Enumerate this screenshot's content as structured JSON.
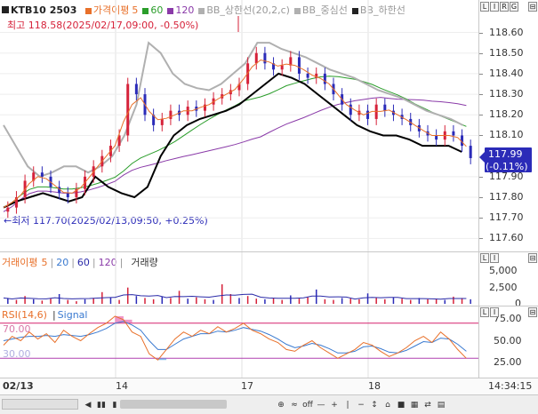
{
  "chart_header": {
    "symbol": "KTB10",
    "code": "2503",
    "legend": [
      {
        "label": "가격이평",
        "color": "#e8702a"
      },
      {
        "label": "5",
        "color": "#e8702a"
      },
      {
        "label": "60",
        "color": "#2a9d2a"
      },
      {
        "label": "120",
        "color": "#8a3aa8"
      },
      {
        "label": "BB_상한선(20,2,c)",
        "color": "#b0b0b0"
      },
      {
        "label": "BB_중심선",
        "color": "#b0b0b0"
      },
      {
        "label": "BB_하한선",
        "color": "#222222"
      }
    ]
  },
  "annotations": {
    "high": "최고 118.58(2025/02/17,09:00, -0.50%)",
    "low": "최저 117.70(2025/02/13,09:50, +0.25%)",
    "current_price": "117.99",
    "current_change": "(-0.11%)"
  },
  "price_axis": [
    "118.60",
    "118.50",
    "118.40",
    "118.30",
    "118.20",
    "118.10",
    "117.90",
    "117.80",
    "117.70",
    "117.60"
  ],
  "volume_header": {
    "title": "거래이평",
    "items": [
      {
        "label": "5",
        "color": "#e8702a"
      },
      {
        "label": "20",
        "color": "#3a7ad0"
      },
      {
        "label": "60",
        "color": "#2a2aa8"
      },
      {
        "label": "120",
        "color": "#8a3aa8"
      }
    ],
    "extra": "거래량"
  },
  "volume_axis": [
    "5,000",
    "2,500",
    "0"
  ],
  "rsi_header": {
    "title": "RSI(14,6)",
    "signal": "Signal",
    "level_high": "70.00",
    "level_low": "30.00"
  },
  "rsi_axis": [
    "75.00",
    "50.00",
    "25.00"
  ],
  "x_axis": {
    "date": "02/13",
    "ticks": [
      "14",
      "17",
      "18"
    ],
    "time": "14:34:15"
  },
  "side_buttons": [
    "L",
    "I",
    "R",
    "G"
  ],
  "toolbar": {
    "buttons": [
      "◀",
      "▮▮",
      "▮",
      "▶",
      "◁",
      "▷",
      "⊕",
      "≈",
      "off",
      "—",
      "+",
      "|",
      "−",
      "↕",
      "⌂",
      "■",
      "▦",
      "⇄",
      "▤"
    ]
  },
  "colors": {
    "up": "#d6223a",
    "down": "#2b2bb8",
    "bb_upper": "#b0b0b0",
    "bb_lower": "#000000",
    "ma5": "#e8702a",
    "ma60": "#2a9d2a",
    "ma120": "#8a3aa8",
    "rsi": "#e8702a",
    "signal": "#3a7ad0",
    "current_price_tag": "#2b2bb8"
  },
  "chart_data": [
    {
      "type": "candlestick",
      "title": "KTB10 2503",
      "ylim": [
        117.55,
        118.68
      ],
      "note": "price chart, intraday, 02/13 to 02/18",
      "series": [
        {
          "name": "Close",
          "values": [
            117.75,
            117.8,
            117.88,
            117.92,
            117.9,
            117.85,
            117.82,
            117.8,
            117.84,
            117.9,
            117.95,
            118.0,
            118.05,
            118.1,
            118.35,
            118.3,
            118.2,
            118.15,
            118.18,
            118.22,
            118.2,
            118.24,
            118.22,
            118.25,
            118.28,
            118.3,
            118.32,
            118.35,
            118.45,
            118.5,
            118.45,
            118.42,
            118.44,
            118.48,
            118.4,
            118.38,
            118.4,
            118.35,
            118.3,
            118.25,
            118.2,
            118.22,
            118.18,
            118.25,
            118.22,
            118.2,
            118.18,
            118.15,
            118.12,
            118.1,
            118.08,
            118.12,
            118.1,
            118.05,
            117.99
          ]
        },
        {
          "name": "BB_상한선",
          "values": [
            118.15,
            118.05,
            117.95,
            117.9,
            117.92,
            117.95,
            117.95,
            117.92,
            117.95,
            118.0,
            118.1,
            118.25,
            118.55,
            118.5,
            118.4,
            118.35,
            118.33,
            118.32,
            118.35,
            118.4,
            118.45,
            118.55,
            118.55,
            118.52,
            118.5,
            118.48,
            118.45,
            118.42,
            118.4,
            118.38,
            118.35,
            118.32,
            118.3,
            118.28,
            118.25,
            118.22,
            118.2,
            118.18,
            118.15
          ]
        },
        {
          "name": "BB_하한선",
          "values": [
            117.75,
            117.78,
            117.8,
            117.82,
            117.8,
            117.78,
            117.8,
            117.9,
            117.85,
            117.82,
            117.8,
            117.85,
            118.0,
            118.1,
            118.15,
            118.18,
            118.2,
            118.22,
            118.25,
            118.3,
            118.35,
            118.4,
            118.38,
            118.35,
            118.3,
            118.25,
            118.2,
            118.15,
            118.12,
            118.1,
            118.1,
            118.08,
            118.05,
            118.05,
            118.05,
            118.02
          ]
        }
      ]
    },
    {
      "type": "bar",
      "title": "거래량",
      "ylim": [
        0,
        6000
      ],
      "series": [
        {
          "name": "거래량",
          "values": [
            900,
            600,
            1200,
            700,
            500,
            800,
            1500,
            600,
            400,
            700,
            900,
            1800,
            1000,
            600,
            2500,
            1200,
            900,
            700,
            1100,
            900,
            2000,
            800,
            1000,
            700,
            600,
            3000,
            1500,
            900,
            1200,
            800,
            700,
            900,
            600,
            1300,
            800,
            1000,
            2200,
            700,
            600,
            900,
            800,
            700,
            1600,
            900,
            700,
            1000,
            800,
            600,
            900,
            700,
            800,
            600,
            1100,
            900,
            700
          ]
        }
      ]
    },
    {
      "type": "line",
      "title": "RSI(14,6)",
      "ylim": [
        10,
        85
      ],
      "series": [
        {
          "name": "RSI",
          "values": [
            45,
            55,
            50,
            60,
            52,
            58,
            48,
            62,
            55,
            50,
            58,
            65,
            70,
            78,
            74,
            60,
            55,
            35,
            28,
            40,
            52,
            60,
            55,
            62,
            58,
            66,
            60,
            64,
            70,
            62,
            58,
            52,
            48,
            40,
            38,
            45,
            50,
            42,
            36,
            30,
            35,
            40,
            48,
            45,
            38,
            32,
            36,
            42,
            50,
            55,
            48,
            60,
            52,
            40,
            30
          ]
        },
        {
          "name": "Signal",
          "values": [
            50,
            52,
            54,
            55,
            55,
            56,
            55,
            57,
            56,
            55,
            57,
            60,
            64,
            70,
            72,
            68,
            62,
            50,
            40,
            40,
            46,
            52,
            55,
            58,
            58,
            61,
            60,
            62,
            65,
            63,
            61,
            57,
            52,
            46,
            42,
            44,
            47,
            45,
            41,
            36,
            36,
            38,
            43,
            44,
            41,
            37,
            36,
            39,
            44,
            49,
            48,
            53,
            52,
            46,
            38
          ]
        }
      ]
    }
  ]
}
